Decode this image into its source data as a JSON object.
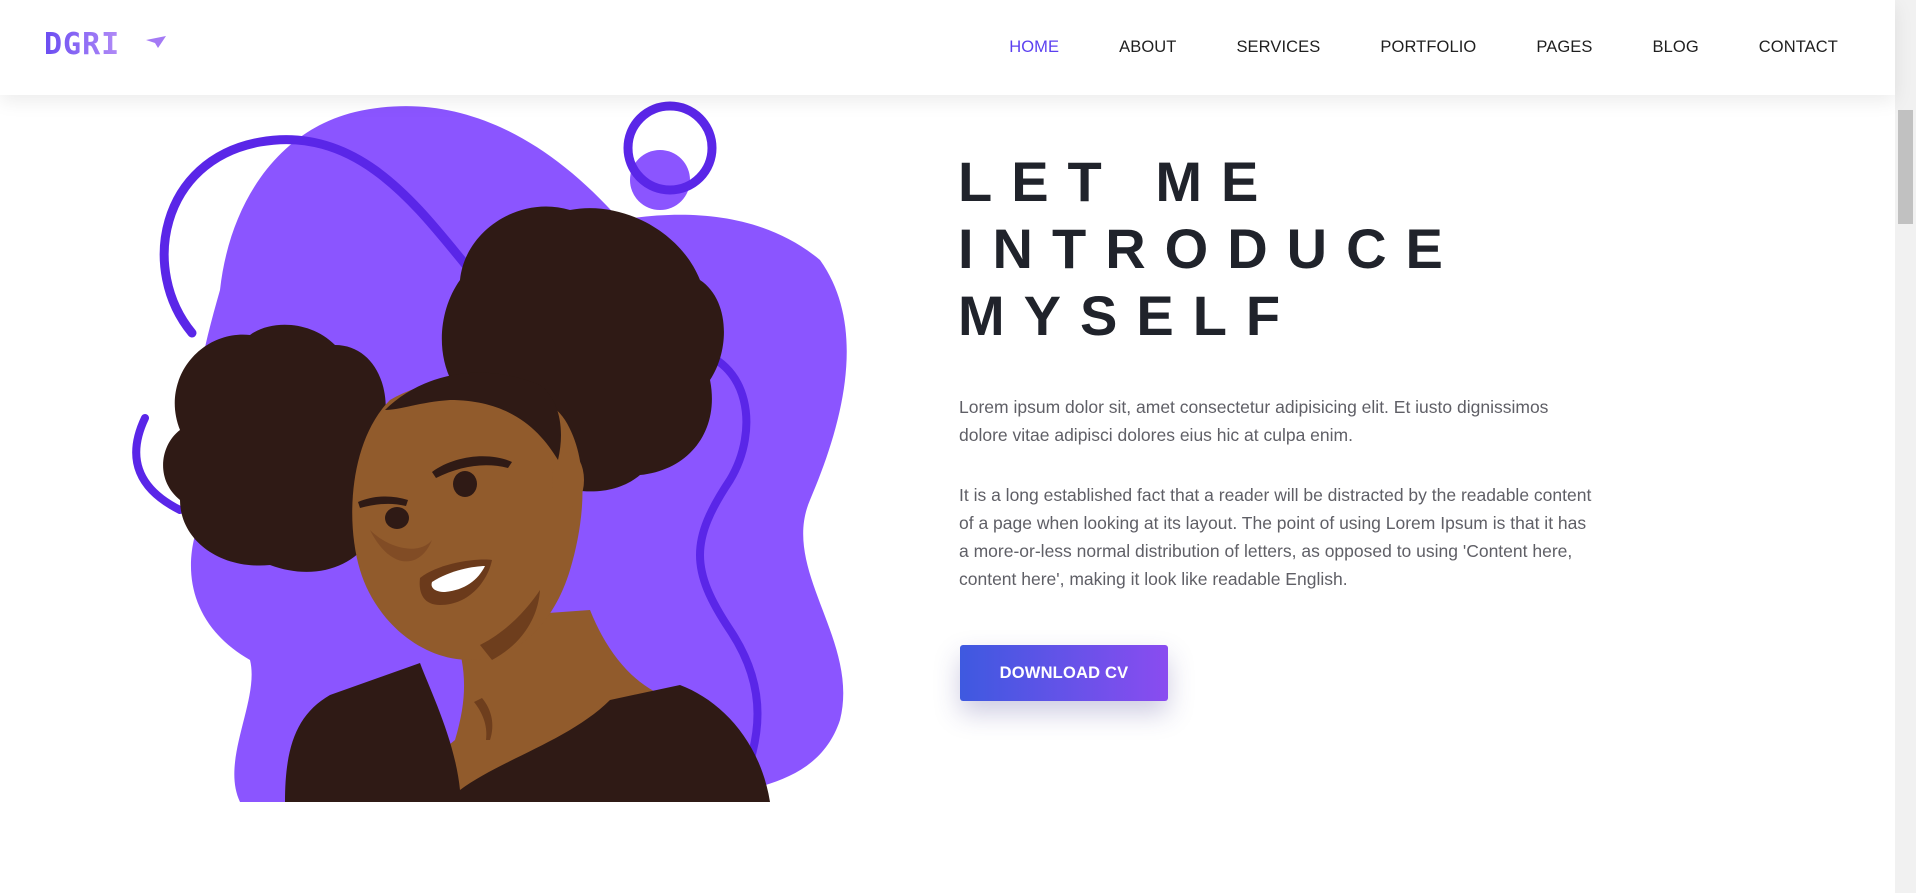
{
  "header": {
    "logo_text": "DGRI",
    "nav": [
      {
        "label": "HOME",
        "active": true
      },
      {
        "label": "ABOUT",
        "active": false
      },
      {
        "label": "SERVICES",
        "active": false
      },
      {
        "label": "PORTFOLIO",
        "active": false
      },
      {
        "label": "PAGES",
        "active": false
      },
      {
        "label": "BLOG",
        "active": false
      },
      {
        "label": "CONTACT",
        "active": false
      }
    ]
  },
  "hero": {
    "title": "LET ME\nINTRODUCE\nMYSELF",
    "paragraph_1": "Lorem ipsum dolor sit, amet consectetur adipisicing elit. Et iusto dignissimos dolore vitae adipisci dolores eius hic at culpa enim.",
    "paragraph_2": "It is a long established fact that a reader will be distracted by the readable content of a page when looking at its layout. The point of using Lorem Ipsum is that it has a more-or-less normal distribution of letters, as opposed to using 'Content here, content here', making it look like readable English.",
    "button_label": "DOWNLOAD CV"
  },
  "colors": {
    "accent": "#5b3ff0",
    "blob": "#8b55ff",
    "line": "#5a26e8",
    "skin": "#915b2c",
    "hair": "#2f1a15",
    "title": "#20232b",
    "body_text": "#5f5f66"
  }
}
